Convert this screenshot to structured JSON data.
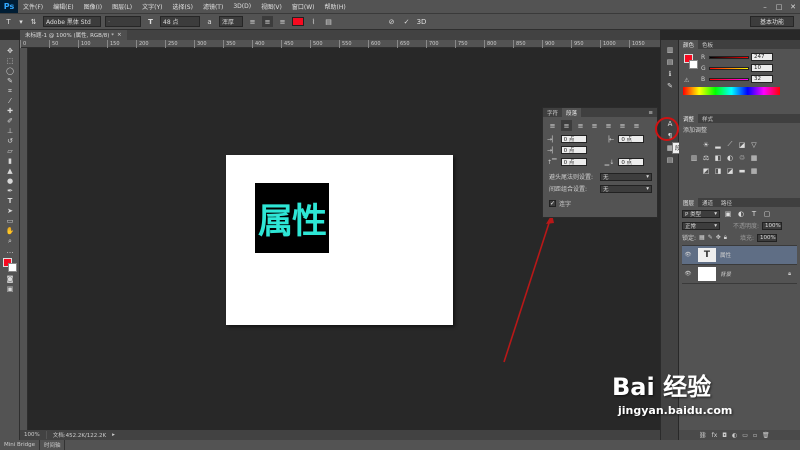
{
  "app": {
    "logo": "Ps"
  },
  "menu": [
    "文件(F)",
    "编辑(E)",
    "图像(I)",
    "图层(L)",
    "文字(Y)",
    "选择(S)",
    "滤镜(T)",
    "3D(D)",
    "视图(V)",
    "窗口(W)",
    "帮助(H)"
  ],
  "options": {
    "font_family": "Adobe 黑体 Std",
    "font_style": "-",
    "font_size": "48 点",
    "antialias": "浑厚",
    "workspace": "基本功能"
  },
  "document": {
    "tab_title": "未标题-1 @ 100% (属性, RGB/8) *",
    "text": "属性",
    "zoom": "100%",
    "doc_info": "文档:452.2K/122.2K"
  },
  "ruler_marks": [
    "0",
    "50",
    "100",
    "150",
    "200",
    "250",
    "300",
    "350",
    "400",
    "450",
    "500",
    "550",
    "600",
    "650",
    "700",
    "750",
    "800",
    "850",
    "900",
    "950",
    "1000",
    "1050"
  ],
  "bottom_tabs": [
    "Mini Bridge",
    "时间轴"
  ],
  "char_panel": {
    "tab_character": "字符",
    "tab_paragraph": "段落",
    "indent_left": "0 点",
    "indent_right": "0 点",
    "indent_first": "0 点",
    "space_before": "0 点",
    "space_after": "0 点",
    "kinsoku_label": "避头尾法则设置:",
    "kinsoku_value": "无",
    "mojikumi_label": "间距组合设置:",
    "mojikumi_value": "无",
    "hyphen_label": "连字"
  },
  "tooltip": "段落",
  "color_panel": {
    "tab_color": "颜色",
    "tab_swatches": "色板",
    "r_label": "R",
    "g_label": "G",
    "b_label": "B",
    "r": "247",
    "g": "10",
    "b": "32",
    "foreground": "#f70a20"
  },
  "adjust_panel": {
    "tab_adjust": "调整",
    "tab_style": "样式",
    "hint": "添加调整"
  },
  "layers_panel": {
    "tab_layers": "图层",
    "tab_channels": "通道",
    "tab_paths": "路径",
    "filter": "P 类型",
    "blend_mode": "正常",
    "opacity_label": "不透明度:",
    "opacity": "100%",
    "lock_label": "锁定:",
    "fill_label": "填充:",
    "fill": "100%",
    "layers": [
      {
        "name": "属性",
        "kind": "T"
      },
      {
        "name": "背景",
        "kind": ""
      }
    ]
  },
  "watermark": {
    "text": "Bai 经验",
    "url": "jingyan.baidu.com"
  },
  "colors": {
    "accent_red": "#d11212",
    "text_cyan": "#2ee6d6"
  }
}
